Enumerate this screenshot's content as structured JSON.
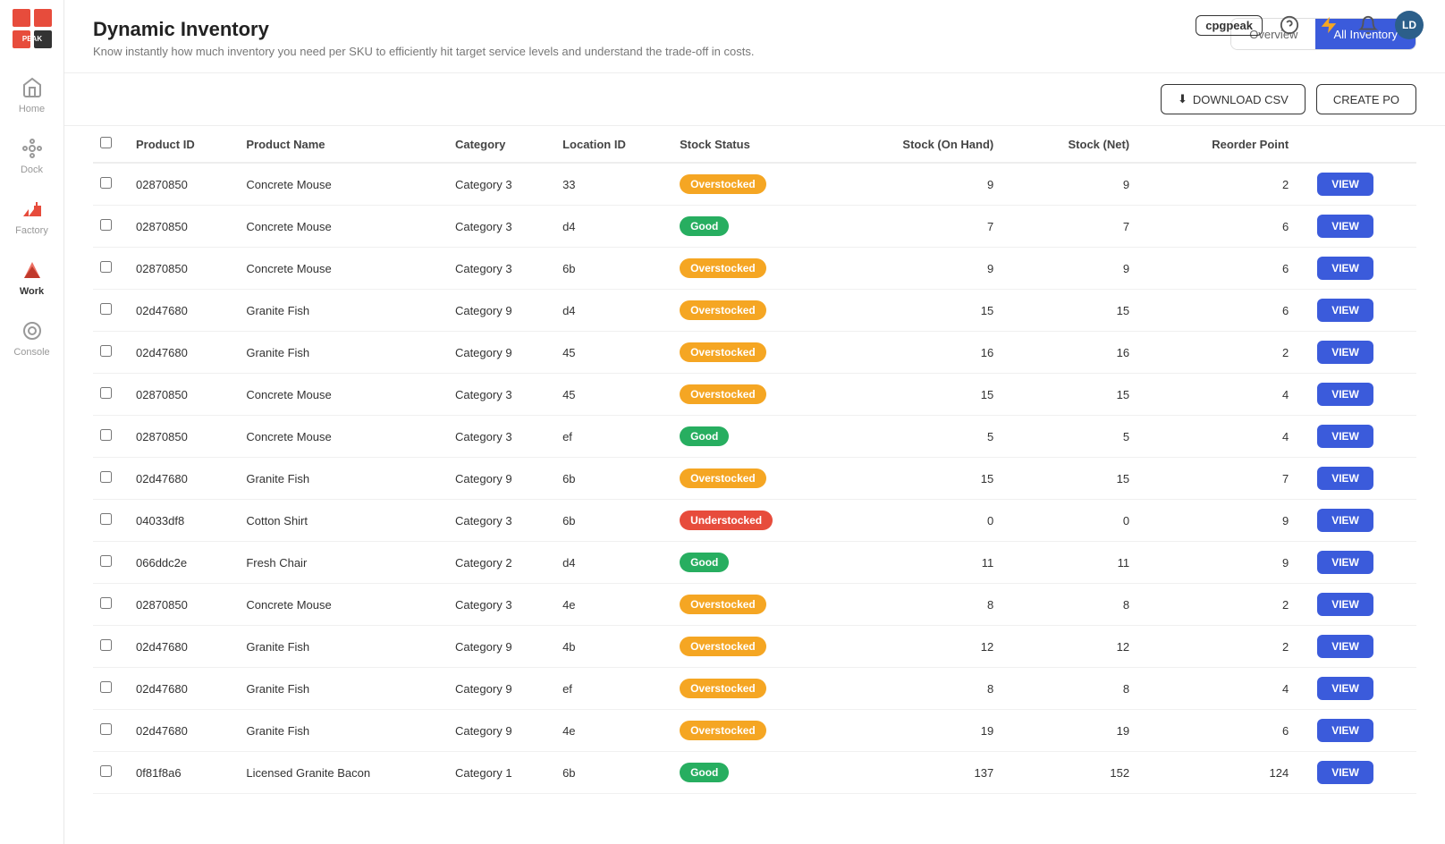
{
  "app": {
    "logo_text": "PEAK",
    "brand": "cpgpeak"
  },
  "topbar": {
    "avatar_text": "LD"
  },
  "sidebar": {
    "items": [
      {
        "label": "Home",
        "icon": "home-icon",
        "active": false
      },
      {
        "label": "Dock",
        "icon": "dock-icon",
        "active": false
      },
      {
        "label": "Factory",
        "icon": "factory-icon",
        "active": false
      },
      {
        "label": "Work",
        "icon": "work-icon",
        "active": true
      },
      {
        "label": "Console",
        "icon": "console-icon",
        "active": false
      }
    ]
  },
  "page": {
    "title": "Dynamic Inventory",
    "subtitle": "Know instantly how much inventory you need per SKU to efficiently hit target service levels and understand the trade-off in costs.",
    "tabs": [
      {
        "label": "Overview",
        "active": false
      },
      {
        "label": "All Inventory",
        "active": true
      }
    ]
  },
  "toolbar": {
    "download_label": "DOWNLOAD CSV",
    "create_label": "CREATE PO"
  },
  "table": {
    "columns": [
      "Product ID",
      "Product Name",
      "Category",
      "Location ID",
      "Stock Status",
      "Stock (On Hand)",
      "Stock (Net)",
      "Reorder Point",
      ""
    ],
    "rows": [
      {
        "product_id": "02870850",
        "product_name": "Concrete Mouse",
        "category": "Category 3",
        "location_id": "33",
        "stock_status": "Overstocked",
        "stock_on_hand": 9,
        "stock_net": 9,
        "reorder_point": 2
      },
      {
        "product_id": "02870850",
        "product_name": "Concrete Mouse",
        "category": "Category 3",
        "location_id": "d4",
        "stock_status": "Good",
        "stock_on_hand": 7,
        "stock_net": 7,
        "reorder_point": 6
      },
      {
        "product_id": "02870850",
        "product_name": "Concrete Mouse",
        "category": "Category 3",
        "location_id": "6b",
        "stock_status": "Overstocked",
        "stock_on_hand": 9,
        "stock_net": 9,
        "reorder_point": 6
      },
      {
        "product_id": "02d47680",
        "product_name": "Granite Fish",
        "category": "Category 9",
        "location_id": "d4",
        "stock_status": "Overstocked",
        "stock_on_hand": 15,
        "stock_net": 15,
        "reorder_point": 6
      },
      {
        "product_id": "02d47680",
        "product_name": "Granite Fish",
        "category": "Category 9",
        "location_id": "45",
        "stock_status": "Overstocked",
        "stock_on_hand": 16,
        "stock_net": 16,
        "reorder_point": 2
      },
      {
        "product_id": "02870850",
        "product_name": "Concrete Mouse",
        "category": "Category 3",
        "location_id": "45",
        "stock_status": "Overstocked",
        "stock_on_hand": 15,
        "stock_net": 15,
        "reorder_point": 4
      },
      {
        "product_id": "02870850",
        "product_name": "Concrete Mouse",
        "category": "Category 3",
        "location_id": "ef",
        "stock_status": "Good",
        "stock_on_hand": 5,
        "stock_net": 5,
        "reorder_point": 4
      },
      {
        "product_id": "02d47680",
        "product_name": "Granite Fish",
        "category": "Category 9",
        "location_id": "6b",
        "stock_status": "Overstocked",
        "stock_on_hand": 15,
        "stock_net": 15,
        "reorder_point": 7
      },
      {
        "product_id": "04033df8",
        "product_name": "Cotton Shirt",
        "category": "Category 3",
        "location_id": "6b",
        "stock_status": "Understocked",
        "stock_on_hand": 0,
        "stock_net": 0,
        "reorder_point": 9
      },
      {
        "product_id": "066ddc2e",
        "product_name": "Fresh Chair",
        "category": "Category 2",
        "location_id": "d4",
        "stock_status": "Good",
        "stock_on_hand": 11,
        "stock_net": 11,
        "reorder_point": 9
      },
      {
        "product_id": "02870850",
        "product_name": "Concrete Mouse",
        "category": "Category 3",
        "location_id": "4e",
        "stock_status": "Overstocked",
        "stock_on_hand": 8,
        "stock_net": 8,
        "reorder_point": 2
      },
      {
        "product_id": "02d47680",
        "product_name": "Granite Fish",
        "category": "Category 9",
        "location_id": "4b",
        "stock_status": "Overstocked",
        "stock_on_hand": 12,
        "stock_net": 12,
        "reorder_point": 2
      },
      {
        "product_id": "02d47680",
        "product_name": "Granite Fish",
        "category": "Category 9",
        "location_id": "ef",
        "stock_status": "Overstocked",
        "stock_on_hand": 8,
        "stock_net": 8,
        "reorder_point": 4
      },
      {
        "product_id": "02d47680",
        "product_name": "Granite Fish",
        "category": "Category 9",
        "location_id": "4e",
        "stock_status": "Overstocked",
        "stock_on_hand": 19,
        "stock_net": 19,
        "reorder_point": 6
      },
      {
        "product_id": "0f81f8a6",
        "product_name": "Licensed Granite Bacon",
        "category": "Category 1",
        "location_id": "6b",
        "stock_status": "Good",
        "stock_on_hand": 137,
        "stock_net": 152,
        "reorder_point": 124
      }
    ]
  }
}
